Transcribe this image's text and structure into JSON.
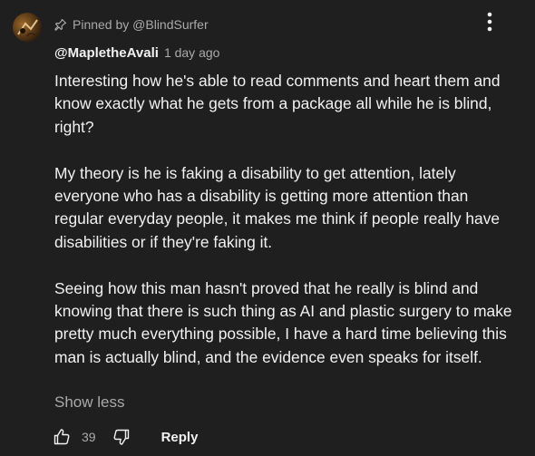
{
  "pinned": {
    "label": "Pinned by @BlindSurfer"
  },
  "comment": {
    "author": "@MapletheAvali",
    "timestamp": "1 day ago",
    "paragraphs": [
      "Interesting how he's able to read comments and heart them and know exactly what he gets from a package all while he is blind, right?",
      "My theory is he is faking a disability to get attention, lately everyone who has a disability is getting more attention than regular everyday people, it makes me think if people really have disabilities or if they're faking it.",
      "Seeing how this man hasn't proved that he really is blind and knowing that there is such thing as AI and plastic surgery to make pretty much everything possible, I have a hard time believing this man is actually blind, and the evidence even speaks for itself."
    ],
    "show_less_label": "Show less"
  },
  "actions": {
    "like_count": "39",
    "reply_label": "Reply"
  },
  "icons": {
    "pin": "pin-icon",
    "menu": "more-vertical-icon",
    "like": "thumbs-up-icon",
    "dislike": "thumbs-down-icon"
  },
  "colors": {
    "background": "#1f1f1f",
    "text_primary": "#f1f1f1",
    "text_secondary": "#aaaaaa"
  }
}
